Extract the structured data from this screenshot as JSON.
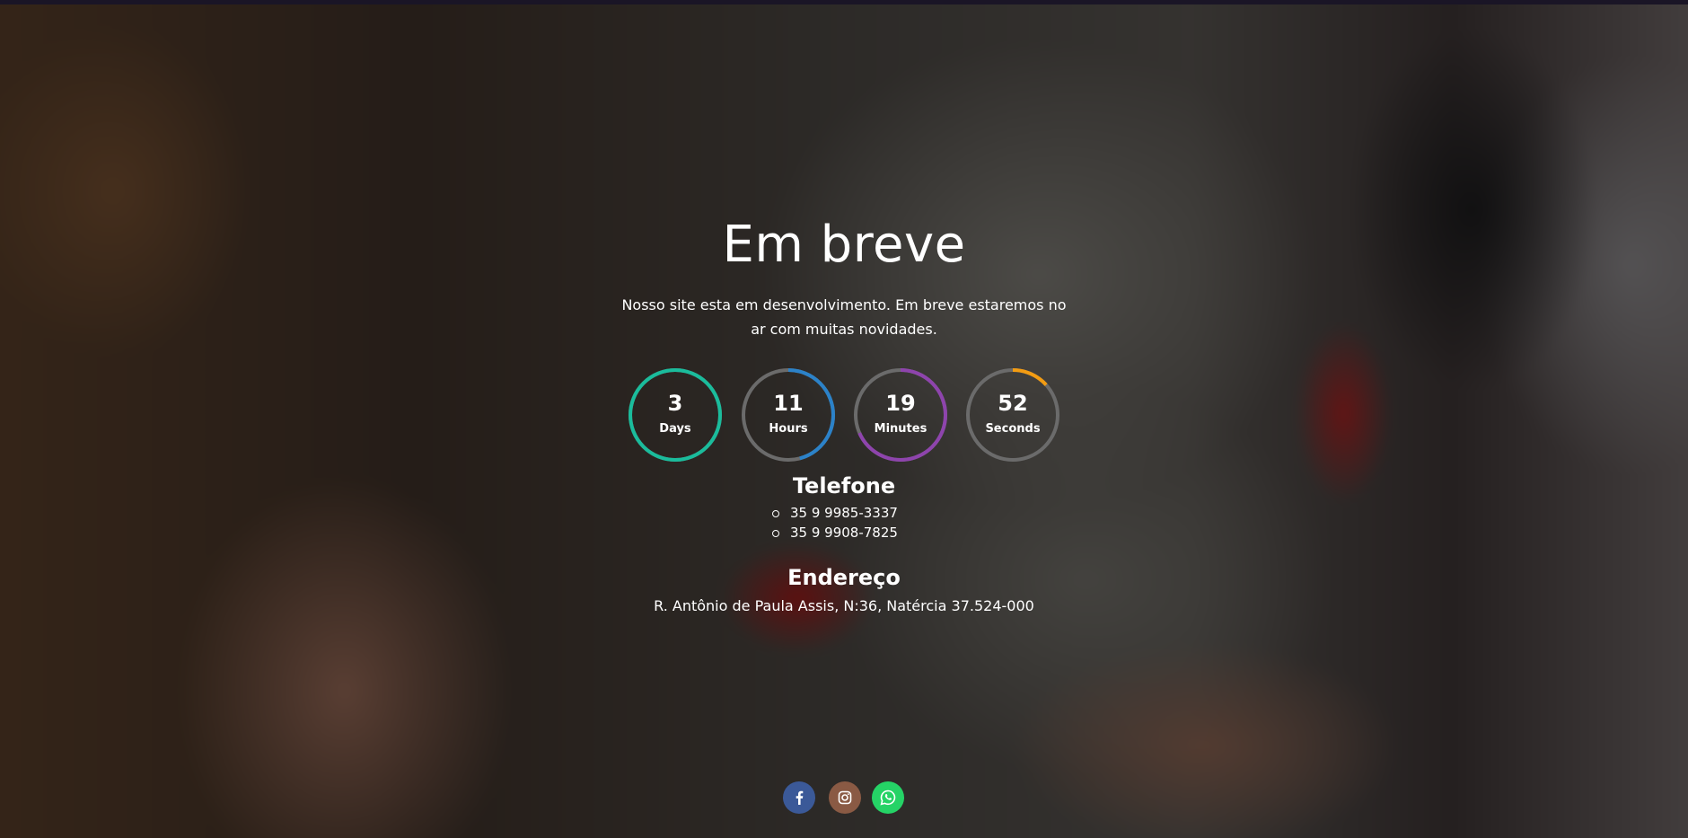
{
  "page": {
    "title": "Em breve",
    "subtitle": "Nosso site esta em desenvolvimento. Em breve estaremos no ar com muitas novidades."
  },
  "countdown": [
    {
      "value": "3",
      "label": "Days",
      "color": "#1abc9c",
      "progress": 1.0
    },
    {
      "value": "11",
      "label": "Hours",
      "color": "#2b82c9",
      "progress": 0.458
    },
    {
      "value": "19",
      "label": "Minutes",
      "color": "#8e44ad",
      "progress": 0.683
    },
    {
      "value": "52",
      "label": "Seconds",
      "color": "#f39c12",
      "progress": 0.133
    }
  ],
  "contact": {
    "phone_title": "Telefone",
    "phones": [
      "35 9 9985-3337",
      "35 9 9908-7825"
    ],
    "address_title": "Endereço",
    "address": "R. Antônio de Paula Assis, N:36, Natércia 37.524-000"
  },
  "social": [
    {
      "name": "facebook",
      "icon": "facebook-icon",
      "color": "#3b5998"
    },
    {
      "name": "instagram",
      "icon": "instagram-icon",
      "color": "#8a5a44"
    },
    {
      "name": "whatsapp",
      "icon": "whatsapp-icon",
      "color": "#25d366"
    }
  ],
  "colors": {
    "track": "#6b6b6b",
    "text": "#ffffff"
  }
}
